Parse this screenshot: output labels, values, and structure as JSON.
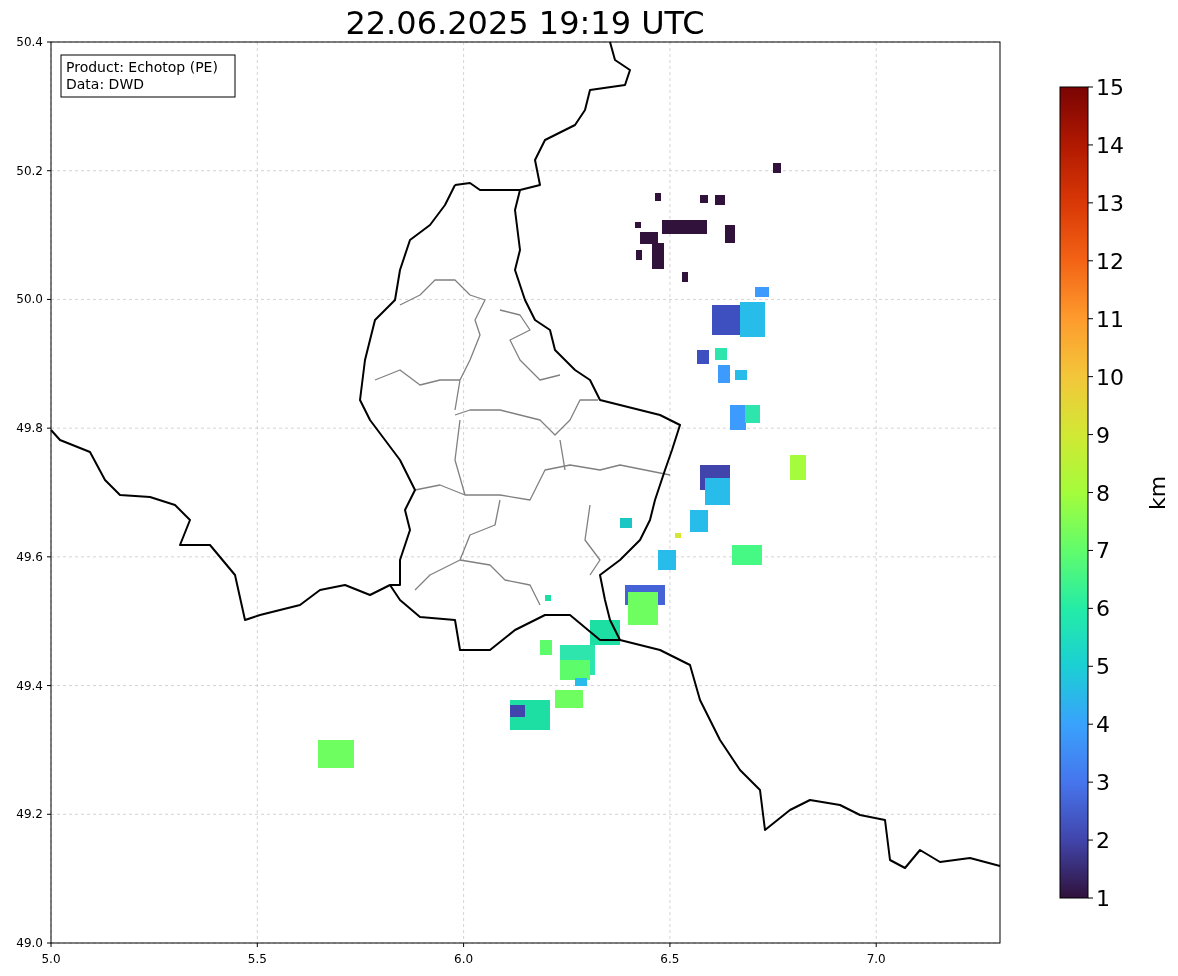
{
  "title": "22.06.2025 19:19 UTC",
  "info_box": [
    "Product: Echotop (PE)",
    "Data: DWD"
  ],
  "x_ticks": [
    "5.0",
    "5.5",
    "6.0",
    "6.5",
    "7.0"
  ],
  "y_ticks": [
    "50.4",
    "50.2",
    "50.0",
    "49.8",
    "49.6",
    "49.4",
    "49.2",
    "49.0"
  ],
  "colorbar": {
    "label": "km",
    "ticks": [
      "15",
      "14",
      "13",
      "12",
      "11",
      "10",
      "9",
      "8",
      "7",
      "6",
      "5",
      "4",
      "3",
      "2",
      "1"
    ]
  }
}
